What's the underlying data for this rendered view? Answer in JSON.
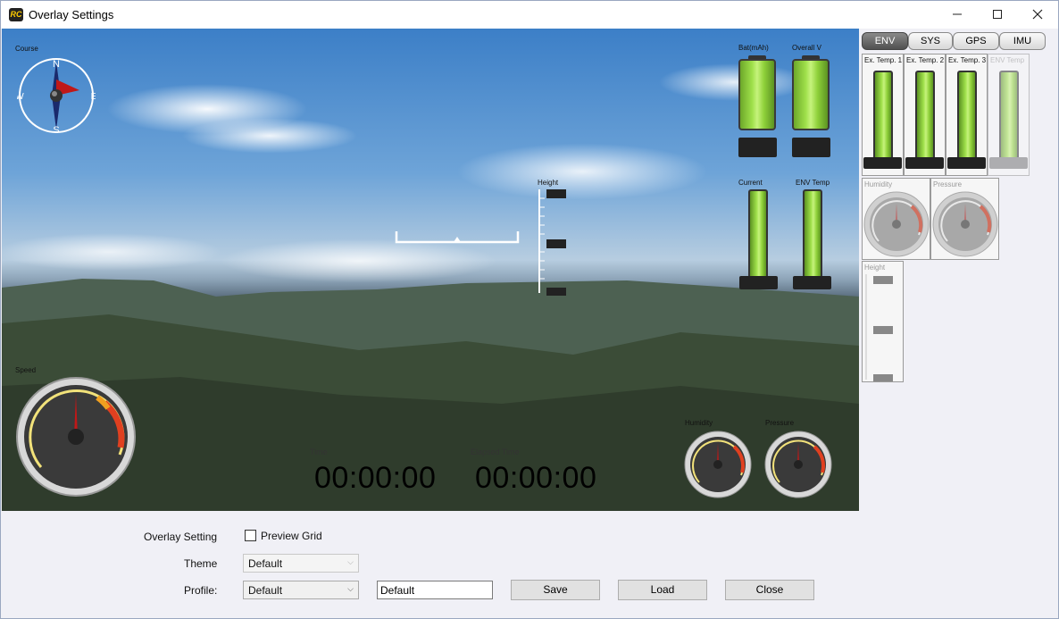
{
  "window": {
    "title": "Overlay Settings",
    "app_icon_text": "RC"
  },
  "overlay": {
    "course_label": "Course",
    "compass": {
      "n": "N",
      "s": "S",
      "e": "E",
      "w": "W"
    },
    "speed_label": "Speed",
    "height_label": "Height",
    "battery": {
      "bat_label": "Bat(mAh)",
      "overall_label": "Overall V"
    },
    "current_label": "Current",
    "env_temp_label": "ENV Temp",
    "humidity_label": "Humidity",
    "pressure_label": "Pressure",
    "time_label": "Time",
    "time_value": "00:00:00",
    "elapsed_label": "Elapsed Time",
    "elapsed_value": "00:00:00"
  },
  "side_panel": {
    "tabs": [
      "ENV",
      "SYS",
      "GPS",
      "IMU"
    ],
    "active_tab": "ENV",
    "temps": [
      {
        "label": "Ex. Temp. 1",
        "enabled": true
      },
      {
        "label": "Ex. Temp. 2",
        "enabled": true
      },
      {
        "label": "Ex. Temp. 3",
        "enabled": true
      },
      {
        "label": "ENV Temp",
        "enabled": false
      }
    ],
    "humidity_label": "Humidity",
    "pressure_label": "Pressure",
    "height_label": "Height"
  },
  "form": {
    "overlay_setting_label": "Overlay Setting",
    "preview_grid_label": "Preview Grid",
    "theme_label": "Theme",
    "theme_value": "Default",
    "profile_label": "Profile:",
    "profile_value": "Default",
    "profile_name_value": "Default",
    "save_label": "Save",
    "load_label": "Load",
    "close_label": "Close"
  },
  "colors": {
    "gauge_red": "#d42020",
    "battery_green": "#9fe04a",
    "tab_active": "#606060"
  }
}
